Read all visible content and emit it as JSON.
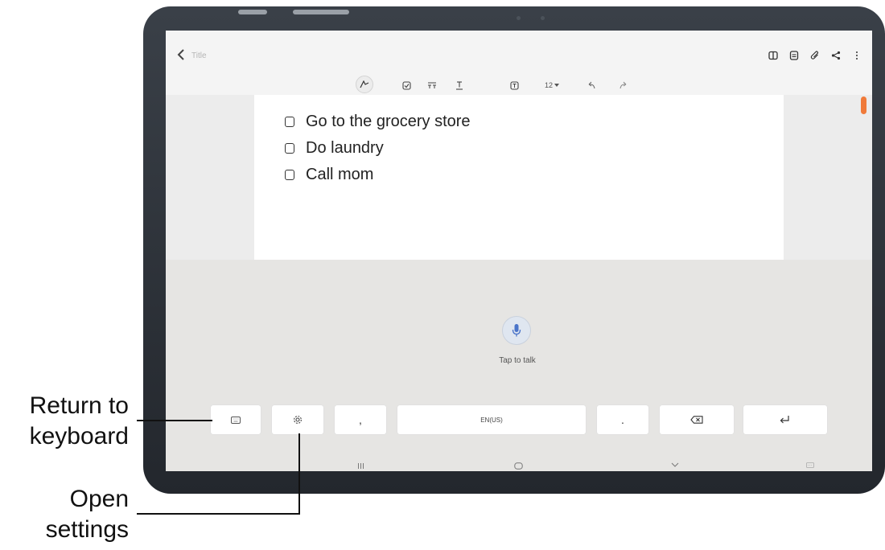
{
  "app": {
    "title": "Title",
    "status_hint": ""
  },
  "toolbar": {
    "font_size": "12"
  },
  "note": {
    "items": [
      {
        "label": "Go to the grocery store",
        "checked": false
      },
      {
        "label": "Do laundry",
        "checked": false
      },
      {
        "label": "Call mom",
        "checked": false
      }
    ]
  },
  "voice": {
    "tap_label": "Tap to talk",
    "keys": {
      "comma": ",",
      "language": "EN(US)",
      "period": "."
    }
  },
  "callouts": {
    "return_keyboard": "Return to\nkeyboard",
    "open_settings": "Open\nsettings"
  },
  "colors": {
    "accent": "#f07a3a",
    "mic_blue": "#4a74c9"
  }
}
